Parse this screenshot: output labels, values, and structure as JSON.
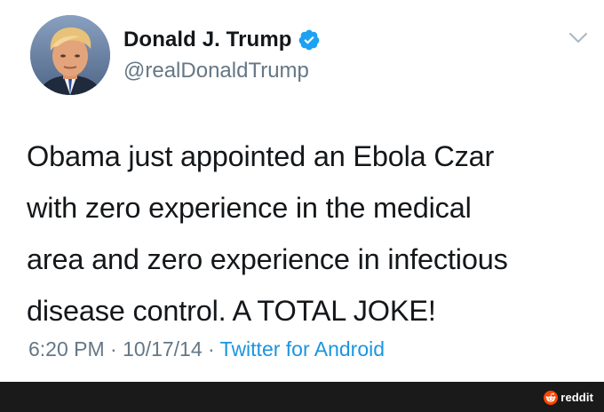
{
  "tweet": {
    "author": {
      "display_name": "Donald J. Trump",
      "handle": "@realDonaldTrump",
      "verified": true,
      "avatar_icon": "profile-photo"
    },
    "text": "Obama just appointed an Ebola Czar\nwith zero experience in the medical\narea and zero experience in infectious\ndisease control. A TOTAL JOKE!",
    "time": "6:20 PM",
    "date": "10/17/14",
    "source": "Twitter for Android",
    "separator": " · ",
    "menu_icon": "chevron-down-icon"
  },
  "footer": {
    "watermark": "reddit",
    "logo_icon": "reddit-logo-icon"
  },
  "colors": {
    "verified_blue": "#1da1f2",
    "link_blue": "#1b95e0",
    "secondary_text": "#657786",
    "primary_text": "#14171a",
    "footer_bg": "#1a1a1b",
    "reddit_orange": "#ff4500"
  }
}
